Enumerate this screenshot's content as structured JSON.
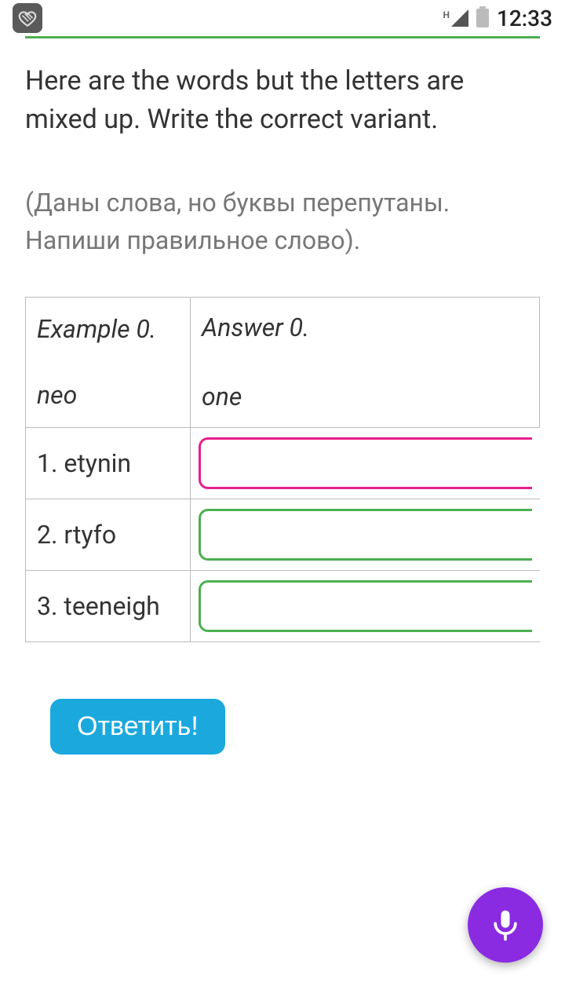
{
  "status": {
    "time": "12:33",
    "network_label": "H"
  },
  "instruction": {
    "en": "Here are the words but the letters are mixed up. Write the correct variant.",
    "ru": "(Даны слова, но буквы перепутаны. Напиши правильное слово)."
  },
  "example": {
    "label": "Example 0.",
    "word": "neo",
    "answer_label": "Answer 0.",
    "answer_value": "one"
  },
  "items": [
    {
      "label": "1. etynin",
      "value": ""
    },
    {
      "label": "2. rtyfo",
      "value": ""
    },
    {
      "label": "3. teeneigh",
      "value": ""
    }
  ],
  "buttons": {
    "submit": "Ответить!"
  }
}
